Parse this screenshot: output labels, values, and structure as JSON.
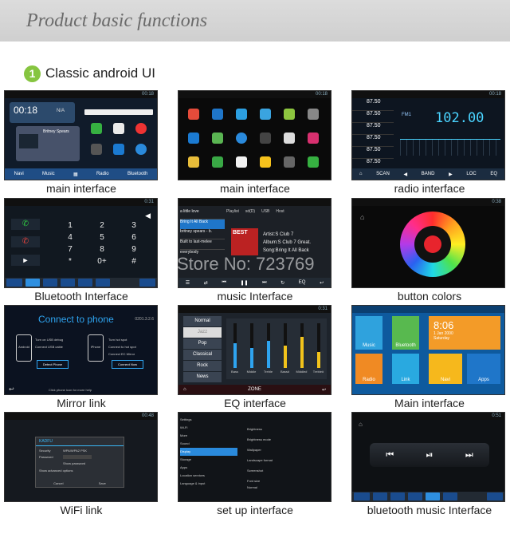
{
  "header": {
    "title": "Product basic functions"
  },
  "section": {
    "number": "1",
    "label": "Classic android UI"
  },
  "watermark": "Store No: 723769",
  "tiles": [
    {
      "caption": "main interface",
      "time": "00:18",
      "nav": [
        "Navi",
        "Music",
        "",
        "Radio",
        "Bluetooth"
      ],
      "song": "Britney Spears",
      "network": "N/A"
    },
    {
      "caption": "main interface",
      "time": "00:18"
    },
    {
      "caption": "radio interface",
      "time": "00:18",
      "freq_big": "102.00",
      "fm_label": "FM1",
      "band_list": [
        "87.50",
        "87.50",
        "87.50",
        "87.50",
        "87.50",
        "87.50"
      ],
      "buttons": [
        "SCAN",
        "BAND",
        "LOC",
        "EQ"
      ]
    },
    {
      "caption": "Bluetooth Interface",
      "time": "0:31",
      "keys": [
        "1",
        "2",
        "3",
        "4",
        "5",
        "6",
        "7",
        "8",
        "9",
        "*",
        "0+",
        "#"
      ]
    },
    {
      "caption": "music Interface",
      "tabs": [
        "Playlist",
        "sd(D)",
        "USB",
        "Host"
      ],
      "playlist": [
        "a little love",
        "Bring It All Back",
        "britney spears - b.",
        "Built to last-melee",
        "everybody"
      ],
      "artist": "Artist:S Club 7",
      "album": "Album:S Club 7 Great.",
      "song": "Song:Bring It All Back",
      "cover": "BEST"
    },
    {
      "caption": "button colors",
      "time": "0:38"
    },
    {
      "caption": "Mirror link",
      "title": "Connect to phone",
      "version": "0201.3.2.6",
      "android": "Android",
      "iphone": "iPhone",
      "step1": "Turn on USB debug",
      "step2": "Connect USB cable",
      "step3": "Turn hot spot",
      "step4": "Connect to hot spot",
      "step5": "Connect EC Mirror",
      "detect_btn": "Detect Phone",
      "connect_btn": "Connect Now",
      "foot": "Click phone icon for more help"
    },
    {
      "caption": "EQ interface",
      "presets": [
        "Normal",
        "Jazz",
        "Pop",
        "Classical",
        "Rock",
        "News"
      ],
      "bands": [
        "Bass",
        "Middle",
        "Treble",
        "Bass#",
        "Middle#",
        "Treble#"
      ],
      "band_levels": [
        0.55,
        0.45,
        0.6,
        0.5,
        0.7,
        0.35
      ],
      "zone": "ZONE",
      "time": "0:31"
    },
    {
      "caption": "Main interface",
      "time": "8:06",
      "date": "1 Jan 2000",
      "day": "Saturday",
      "apps": [
        {
          "label": "Music",
          "color": "#2fa2dd"
        },
        {
          "label": "Bluetooth",
          "color": "#58b94f"
        },
        {
          "label": "Radio",
          "color": "#f08a23"
        },
        {
          "label": "Link",
          "color": "#29a9e0"
        },
        {
          "label": "Navi",
          "color": "#f6b81c"
        },
        {
          "label": "Apps",
          "color": "#1f76c9"
        }
      ]
    },
    {
      "caption": "WiFi link",
      "time": "00:48",
      "dialog_title": "KADFU",
      "ssid_label": "Security",
      "ssid_value": "WPA/WPA2 PSK",
      "pwd_label": "Password",
      "show_pwd": "Show password",
      "adv": "Show advanced options",
      "cancel": "Cancel",
      "save": "Save"
    },
    {
      "caption": "set up interface",
      "menu": [
        "Settings",
        "Wi-Fi",
        "More",
        "Sound",
        "Display",
        "Storage",
        "Apps",
        "Location services",
        "Language & input"
      ],
      "options": [
        "Brightness",
        "Brightness mode",
        "Wallpaper",
        "Landscape format",
        "Screenshot",
        "Font size"
      ],
      "font_value": "Normal"
    },
    {
      "caption": "bluetooth music Interface",
      "time": "0:51"
    }
  ]
}
